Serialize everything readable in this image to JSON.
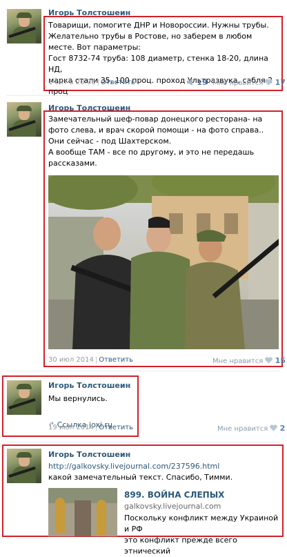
{
  "author": "Игорь Толстошеин",
  "reply_label": "Ответить",
  "likes_label": "Мне нравится",
  "posts": [
    {
      "text": "Товарищи, помогите ДНР и Новороссии. Нужны трубы.\nЖелательно трубы в Ростове, но заберем в любом месте. Вот параметры:\nГост 8732-74 труба: 108 диаметр, стенка 18-20, длина НД,\nмарка стали 35, 100 проц. проход Ультразвука, сабля 2 проц",
      "date": "1 окт в 20:36",
      "reposts": "19",
      "likes": "17"
    },
    {
      "text": "Замечательный шеф-повар донецкого ресторана- на фото слева, и врач скорой помощи - на фото справа.. Они сейчас - под Шахтерском.\nА вообще ТАМ - все по другому, и это не передашь рассказами.",
      "date": "30 июл 2014",
      "likes": "15"
    },
    {
      "text": "Мы вернулись.",
      "link_label": "Ссылка joxi.ru",
      "date": "19 июл 2014",
      "likes": "2"
    },
    {
      "url": "http://galkovsky.livejournal.com/237596.html",
      "text": "какой замечательный текст. Спасибо, Тимми.",
      "snippet": {
        "title": "899. ВОЙНА СЛЕПЫХ",
        "site": "galkovsky.livejournal.com",
        "text": "Поскольку конфликт между Украиной и РФ\nэто конфликт прежде всего этнический"
      }
    }
  ],
  "colors": {
    "accent": "#2b587a",
    "highlight_box": "#d0202a",
    "meta": "#999999"
  }
}
